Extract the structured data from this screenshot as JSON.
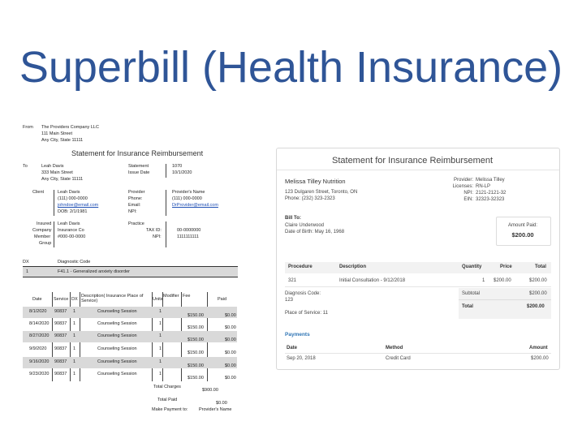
{
  "title": "Superbill (Health Insurance)",
  "left": {
    "from_label": "From",
    "from_lines": [
      "The Providers Company LLC",
      "111 Main Street",
      "Any City, State 11111"
    ],
    "heading": "Statement for Insurance Reimbursement",
    "to_label": "To",
    "to_lines": [
      "Leah Davis",
      "333 Main Street",
      "Any City, State 11111"
    ],
    "statement_label": "Statement",
    "statement_value": "1070",
    "issue_label": "Issue Date",
    "issue_value": "10/1/2020",
    "client_label": "Client",
    "client_lines": [
      "Leah Davis",
      "(111) 000-0000",
      "johndoe@email.com",
      "DOB:    2/1/1981"
    ],
    "provider_label": "Provider",
    "provider_field_labels": [
      "Phone:",
      "Email:",
      "NPI:"
    ],
    "provider_values": [
      "Provider's Name",
      "(111) 000-0000",
      "DrProvider@email.com"
    ],
    "insured_labels": [
      "Insured",
      "Company",
      "Member",
      "Group"
    ],
    "insured_values": [
      "Leah Davis",
      "Insurance Co",
      "#000-00-0000"
    ],
    "practice_label": "Practice",
    "tax_label": "TAX ID:",
    "tax_value": "00-0000000",
    "npi_label": "NPI:",
    "npi_value": "1111111111",
    "dx_header": "DX",
    "dx_code_header": "Diagnostic Code",
    "dx_row_num": "1",
    "dx_row_code": "F41.1 - Generalized anxiety disorder",
    "table_headers": {
      "date": "Date",
      "service": "Service",
      "dx": "DX",
      "description": "Description( Insurance Place of Service)",
      "units": "Units",
      "modifier": "Modifier",
      "fee": "Fee",
      "paid": "Paid"
    },
    "rows": [
      {
        "date": "8/1/2020",
        "service": "90837",
        "dx": "1",
        "desc": "Counseling Session",
        "units": "1",
        "fee": "$150.00",
        "paid": "$0.00"
      },
      {
        "date": "8/14/2020",
        "service": "90837",
        "dx": "1",
        "desc": "Counseling Session",
        "units": "1",
        "fee": "$150.00",
        "paid": "$0.00"
      },
      {
        "date": "8/27/2020",
        "service": "90837",
        "dx": "1",
        "desc": "Counseling Session",
        "units": "1",
        "fee": "$150.00",
        "paid": "$0.00"
      },
      {
        "date": "9/9/2020",
        "service": "90837",
        "dx": "1",
        "desc": "Counseling Session",
        "units": "1",
        "fee": "$150.00",
        "paid": "$0.00"
      },
      {
        "date": "9/16/2020",
        "service": "90837",
        "dx": "1",
        "desc": "Counseling Session",
        "units": "1",
        "fee": "$150.00",
        "paid": "$0.00"
      },
      {
        "date": "9/23/2020",
        "service": "90837",
        "dx": "1",
        "desc": "Counseling Session",
        "units": "1",
        "fee": "$150.00",
        "paid": "$0.00"
      }
    ],
    "total_charges_label": "Total Charges",
    "total_charges_value": "$900.00",
    "total_paid_label": "Total Paid",
    "total_paid_value": "$0.00",
    "make_payment_label": "Make Payment to:",
    "make_payment_value": "Provider's Name"
  },
  "right": {
    "heading": "Statement for Insurance Reimbursement",
    "org_name": "Melissa Tilley Nutrition",
    "org_address": "123 Dulgaren Street, Toronto, ON",
    "org_phone": "Phone: (232) 323-2323",
    "provider_labels": [
      "Provider:",
      "Licenses:",
      "NPI:",
      "EIN:"
    ],
    "provider_values": [
      "Melissa Tilley",
      "RN-LP",
      "2121-2121-32",
      "32323-32323"
    ],
    "bill_to_label": "Bill To:",
    "bill_to_name": "Claire Underwood",
    "bill_to_dob": "Date of Birth: May 16, 1968",
    "amount_paid_label": "Amount Paid:",
    "amount_paid_value": "$200.00",
    "table_headers": {
      "procedure": "Procedure",
      "description": "Description",
      "quantity": "Quantity",
      "price": "Price",
      "total": "Total"
    },
    "row": {
      "procedure": "321",
      "description": "Initial Consultation - 9/12/2018",
      "quantity": "1",
      "price": "$200.00",
      "total": "$200.00"
    },
    "diagnosis_label": "Diagnosis Code:",
    "diagnosis_value": "123",
    "place_label": "Place of Service: 11",
    "subtotal_label": "Subtotal",
    "subtotal_value": "$200.00",
    "total_label": "Total",
    "total_value": "$200.00",
    "payments_title": "Payments",
    "payments_headers": {
      "date": "Date",
      "method": "Method",
      "amount": "Amount"
    },
    "payment_row": {
      "date": "Sep 20, 2018",
      "method": "Credit Card",
      "amount": "$200.00"
    }
  }
}
